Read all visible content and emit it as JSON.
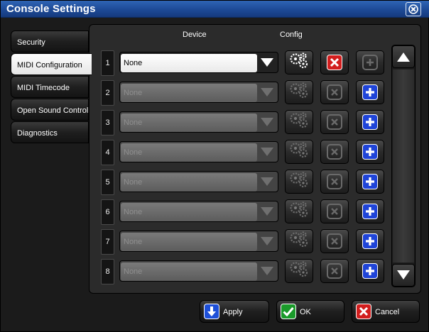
{
  "window": {
    "title": "Console Settings"
  },
  "tabs": [
    {
      "label": "Security",
      "active": false
    },
    {
      "label": "MIDI Configuration",
      "active": true
    },
    {
      "label": "MIDI Timecode",
      "active": false
    },
    {
      "label": "Open Sound Control",
      "active": false
    },
    {
      "label": "Diagnostics",
      "active": false
    }
  ],
  "columns": {
    "device": "Device",
    "config": "Config"
  },
  "rows": [
    {
      "index": "1",
      "device": "None",
      "enabled": true
    },
    {
      "index": "2",
      "device": "None",
      "enabled": false
    },
    {
      "index": "3",
      "device": "None",
      "enabled": false
    },
    {
      "index": "4",
      "device": "None",
      "enabled": false
    },
    {
      "index": "5",
      "device": "None",
      "enabled": false
    },
    {
      "index": "6",
      "device": "None",
      "enabled": false
    },
    {
      "index": "7",
      "device": "None",
      "enabled": false
    },
    {
      "index": "8",
      "device": "None",
      "enabled": false
    }
  ],
  "buttons": {
    "apply": "Apply",
    "ok": "OK",
    "cancel": "Cancel"
  },
  "icons": {
    "config": "gears-icon",
    "remove": "remove-x-icon",
    "add": "add-plus-icon",
    "scroll_up": "arrow-up-icon",
    "scroll_down": "arrow-down-icon"
  },
  "colors": {
    "title_bar": "#1d4a96",
    "remove_red": "#d21e1e",
    "add_blue": "#1f44d8",
    "ok_green": "#1a9a2a",
    "apply_blue": "#1d4fd8"
  }
}
